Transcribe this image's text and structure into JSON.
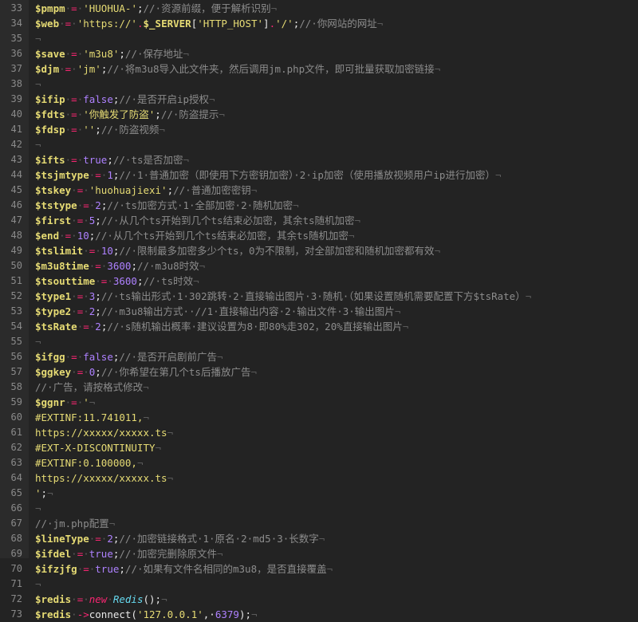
{
  "lines": [
    {
      "num": "33",
      "tokens": [
        {
          "t": "v",
          "x": "$pmpm"
        },
        {
          "t": "w",
          "x": "·"
        },
        {
          "t": "o",
          "x": "="
        },
        {
          "t": "w",
          "x": "·"
        },
        {
          "t": "s",
          "x": "'HUOHUA-'"
        },
        {
          "t": "t",
          "x": ";"
        },
        {
          "t": "c",
          "x": "//·资源前缀，便于解析识别"
        },
        {
          "t": "w",
          "x": "¬"
        }
      ]
    },
    {
      "num": "34",
      "tokens": [
        {
          "t": "v",
          "x": "$web"
        },
        {
          "t": "w",
          "x": "·"
        },
        {
          "t": "o",
          "x": "="
        },
        {
          "t": "w",
          "x": "·"
        },
        {
          "t": "s",
          "x": "'https://'"
        },
        {
          "t": "o",
          "x": "."
        },
        {
          "t": "v",
          "x": "$_SERVER"
        },
        {
          "t": "t",
          "x": "["
        },
        {
          "t": "s",
          "x": "'HTTP_HOST'"
        },
        {
          "t": "t",
          "x": "]"
        },
        {
          "t": "o",
          "x": "."
        },
        {
          "t": "s",
          "x": "'/'"
        },
        {
          "t": "t",
          "x": ";"
        },
        {
          "t": "c",
          "x": "//·你网站的网址"
        },
        {
          "t": "w",
          "x": "¬"
        }
      ]
    },
    {
      "num": "35",
      "tokens": [
        {
          "t": "w",
          "x": "¬"
        }
      ]
    },
    {
      "num": "36",
      "tokens": [
        {
          "t": "v",
          "x": "$save"
        },
        {
          "t": "w",
          "x": "·"
        },
        {
          "t": "o",
          "x": "="
        },
        {
          "t": "w",
          "x": "·"
        },
        {
          "t": "s",
          "x": "'m3u8'"
        },
        {
          "t": "t",
          "x": ";"
        },
        {
          "t": "c",
          "x": "//·保存地址"
        },
        {
          "t": "w",
          "x": "¬"
        }
      ]
    },
    {
      "num": "37",
      "tokens": [
        {
          "t": "v",
          "x": "$djm"
        },
        {
          "t": "w",
          "x": "·"
        },
        {
          "t": "o",
          "x": "="
        },
        {
          "t": "w",
          "x": "·"
        },
        {
          "t": "s",
          "x": "'jm'"
        },
        {
          "t": "t",
          "x": ";"
        },
        {
          "t": "c",
          "x": "//·将m3u8导入此文件夹，然后调用jm.php文件，即可批量获取加密链接"
        },
        {
          "t": "w",
          "x": "¬"
        }
      ]
    },
    {
      "num": "38",
      "tokens": [
        {
          "t": "w",
          "x": "¬"
        }
      ]
    },
    {
      "num": "39",
      "tokens": [
        {
          "t": "v",
          "x": "$ifip"
        },
        {
          "t": "w",
          "x": "·"
        },
        {
          "t": "o",
          "x": "="
        },
        {
          "t": "w",
          "x": "·"
        },
        {
          "t": "n",
          "x": "false"
        },
        {
          "t": "t",
          "x": ";"
        },
        {
          "t": "c",
          "x": "//·是否开启ip授权"
        },
        {
          "t": "w",
          "x": "¬"
        }
      ]
    },
    {
      "num": "40",
      "tokens": [
        {
          "t": "v",
          "x": "$fdts"
        },
        {
          "t": "w",
          "x": "·"
        },
        {
          "t": "o",
          "x": "="
        },
        {
          "t": "w",
          "x": "·"
        },
        {
          "t": "s",
          "x": "'你触发了防盗'"
        },
        {
          "t": "t",
          "x": ";"
        },
        {
          "t": "c",
          "x": "//·防盗提示"
        },
        {
          "t": "w",
          "x": "¬"
        }
      ]
    },
    {
      "num": "41",
      "tokens": [
        {
          "t": "v",
          "x": "$fdsp"
        },
        {
          "t": "w",
          "x": "·"
        },
        {
          "t": "o",
          "x": "="
        },
        {
          "t": "w",
          "x": "·"
        },
        {
          "t": "s",
          "x": "''"
        },
        {
          "t": "t",
          "x": ";"
        },
        {
          "t": "c",
          "x": "//·防盗视频"
        },
        {
          "t": "w",
          "x": "¬"
        }
      ]
    },
    {
      "num": "42",
      "tokens": [
        {
          "t": "w",
          "x": "¬"
        }
      ]
    },
    {
      "num": "43",
      "tokens": [
        {
          "t": "v",
          "x": "$ifts"
        },
        {
          "t": "w",
          "x": "·"
        },
        {
          "t": "o",
          "x": "="
        },
        {
          "t": "w",
          "x": "·"
        },
        {
          "t": "n",
          "x": "true"
        },
        {
          "t": "t",
          "x": ";"
        },
        {
          "t": "c",
          "x": "//·ts是否加密"
        },
        {
          "t": "w",
          "x": "¬"
        }
      ]
    },
    {
      "num": "44",
      "tokens": [
        {
          "t": "v",
          "x": "$tsjmtype"
        },
        {
          "t": "w",
          "x": "·"
        },
        {
          "t": "o",
          "x": "="
        },
        {
          "t": "w",
          "x": "·"
        },
        {
          "t": "n",
          "x": "1"
        },
        {
          "t": "t",
          "x": ";"
        },
        {
          "t": "c",
          "x": "//·1·普通加密（即使用下方密钥加密）·2·ip加密（使用播放视频用户ip进行加密）"
        },
        {
          "t": "w",
          "x": "¬"
        }
      ]
    },
    {
      "num": "45",
      "tokens": [
        {
          "t": "v",
          "x": "$tskey"
        },
        {
          "t": "w",
          "x": "·"
        },
        {
          "t": "o",
          "x": "="
        },
        {
          "t": "w",
          "x": "·"
        },
        {
          "t": "s",
          "x": "'huohuajiexi'"
        },
        {
          "t": "t",
          "x": ";"
        },
        {
          "t": "c",
          "x": "//·普通加密密钥"
        },
        {
          "t": "w",
          "x": "¬"
        }
      ]
    },
    {
      "num": "46",
      "tokens": [
        {
          "t": "v",
          "x": "$tstype"
        },
        {
          "t": "w",
          "x": "·"
        },
        {
          "t": "o",
          "x": "="
        },
        {
          "t": "w",
          "x": "·"
        },
        {
          "t": "n",
          "x": "2"
        },
        {
          "t": "t",
          "x": ";"
        },
        {
          "t": "c",
          "x": "//·ts加密方式·1·全部加密·2·随机加密"
        },
        {
          "t": "w",
          "x": "¬"
        }
      ]
    },
    {
      "num": "47",
      "tokens": [
        {
          "t": "v",
          "x": "$first"
        },
        {
          "t": "w",
          "x": "·"
        },
        {
          "t": "o",
          "x": "="
        },
        {
          "t": "w",
          "x": "·"
        },
        {
          "t": "n",
          "x": "5"
        },
        {
          "t": "t",
          "x": ";"
        },
        {
          "t": "c",
          "x": "//·从几个ts开始到几个ts结束必加密，其余ts随机加密"
        },
        {
          "t": "w",
          "x": "¬"
        }
      ]
    },
    {
      "num": "48",
      "tokens": [
        {
          "t": "v",
          "x": "$end"
        },
        {
          "t": "w",
          "x": "·"
        },
        {
          "t": "o",
          "x": "="
        },
        {
          "t": "w",
          "x": "·"
        },
        {
          "t": "n",
          "x": "10"
        },
        {
          "t": "t",
          "x": ";"
        },
        {
          "t": "c",
          "x": "//·从几个ts开始到几个ts结束必加密，其余ts随机加密"
        },
        {
          "t": "w",
          "x": "¬"
        }
      ]
    },
    {
      "num": "49",
      "tokens": [
        {
          "t": "v",
          "x": "$tslimit"
        },
        {
          "t": "w",
          "x": "·"
        },
        {
          "t": "o",
          "x": "="
        },
        {
          "t": "w",
          "x": "·"
        },
        {
          "t": "n",
          "x": "10"
        },
        {
          "t": "t",
          "x": ";"
        },
        {
          "t": "c",
          "x": "//·限制最多加密多少个ts，0为不限制，对全部加密和随机加密都有效"
        },
        {
          "t": "w",
          "x": "¬"
        }
      ]
    },
    {
      "num": "50",
      "tokens": [
        {
          "t": "v",
          "x": "$m3u8time"
        },
        {
          "t": "w",
          "x": "·"
        },
        {
          "t": "o",
          "x": "="
        },
        {
          "t": "w",
          "x": "·"
        },
        {
          "t": "n",
          "x": "3600"
        },
        {
          "t": "t",
          "x": ";"
        },
        {
          "t": "c",
          "x": "//·m3u8时效"
        },
        {
          "t": "w",
          "x": "¬"
        }
      ]
    },
    {
      "num": "51",
      "tokens": [
        {
          "t": "v",
          "x": "$tsouttime"
        },
        {
          "t": "w",
          "x": "·"
        },
        {
          "t": "o",
          "x": "="
        },
        {
          "t": "w",
          "x": "·"
        },
        {
          "t": "n",
          "x": "3600"
        },
        {
          "t": "t",
          "x": ";"
        },
        {
          "t": "c",
          "x": "//·ts时效"
        },
        {
          "t": "w",
          "x": "¬"
        }
      ]
    },
    {
      "num": "52",
      "tokens": [
        {
          "t": "v",
          "x": "$type1"
        },
        {
          "t": "w",
          "x": "·"
        },
        {
          "t": "o",
          "x": "="
        },
        {
          "t": "w",
          "x": "·"
        },
        {
          "t": "n",
          "x": "3"
        },
        {
          "t": "t",
          "x": ";"
        },
        {
          "t": "c",
          "x": "//·ts输出形式·1·302跳转·2·直接输出图片·3·随机·（如果设置随机需要配置下方$tsRate）"
        },
        {
          "t": "w",
          "x": "¬"
        }
      ]
    },
    {
      "num": "53",
      "tokens": [
        {
          "t": "v",
          "x": "$type2"
        },
        {
          "t": "w",
          "x": "·"
        },
        {
          "t": "o",
          "x": "="
        },
        {
          "t": "w",
          "x": "·"
        },
        {
          "t": "n",
          "x": "2"
        },
        {
          "t": "t",
          "x": ";"
        },
        {
          "t": "c",
          "x": "//·m3u8输出方式··//1·直接输出内容·2·输出文件·3·输出图片"
        },
        {
          "t": "w",
          "x": "¬"
        }
      ]
    },
    {
      "num": "54",
      "tokens": [
        {
          "t": "v",
          "x": "$tsRate"
        },
        {
          "t": "w",
          "x": "·"
        },
        {
          "t": "o",
          "x": "="
        },
        {
          "t": "w",
          "x": "·"
        },
        {
          "t": "n",
          "x": "2"
        },
        {
          "t": "t",
          "x": ";"
        },
        {
          "t": "c",
          "x": "//·s随机输出概率·建议设置为8·即80%走302，20%直接输出图片"
        },
        {
          "t": "w",
          "x": "¬"
        }
      ]
    },
    {
      "num": "55",
      "tokens": [
        {
          "t": "w",
          "x": "¬"
        }
      ]
    },
    {
      "num": "56",
      "tokens": [
        {
          "t": "v",
          "x": "$ifgg"
        },
        {
          "t": "w",
          "x": "·"
        },
        {
          "t": "o",
          "x": "="
        },
        {
          "t": "w",
          "x": "·"
        },
        {
          "t": "n",
          "x": "false"
        },
        {
          "t": "t",
          "x": ";"
        },
        {
          "t": "c",
          "x": "//·是否开启剧前广告"
        },
        {
          "t": "w",
          "x": "¬"
        }
      ]
    },
    {
      "num": "57",
      "tokens": [
        {
          "t": "v",
          "x": "$ggkey"
        },
        {
          "t": "w",
          "x": "·"
        },
        {
          "t": "o",
          "x": "="
        },
        {
          "t": "w",
          "x": "·"
        },
        {
          "t": "n",
          "x": "0"
        },
        {
          "t": "t",
          "x": ";"
        },
        {
          "t": "c",
          "x": "//·你希望在第几个ts后播放广告"
        },
        {
          "t": "w",
          "x": "¬"
        }
      ]
    },
    {
      "num": "58",
      "tokens": [
        {
          "t": "c",
          "x": "//·广告，请按格式修改"
        },
        {
          "t": "w",
          "x": "¬"
        }
      ]
    },
    {
      "num": "59",
      "tokens": [
        {
          "t": "v",
          "x": "$ggnr"
        },
        {
          "t": "w",
          "x": "·"
        },
        {
          "t": "o",
          "x": "="
        },
        {
          "t": "w",
          "x": "·"
        },
        {
          "t": "s",
          "x": "'"
        },
        {
          "t": "w",
          "x": "¬"
        }
      ]
    },
    {
      "num": "60",
      "tokens": [
        {
          "t": "s",
          "x": "#EXTINF:11.741011,"
        },
        {
          "t": "w",
          "x": "¬"
        }
      ]
    },
    {
      "num": "61",
      "tokens": [
        {
          "t": "s",
          "x": "https://xxxxx/xxxxx.ts"
        },
        {
          "t": "w",
          "x": "¬"
        }
      ]
    },
    {
      "num": "62",
      "tokens": [
        {
          "t": "s",
          "x": "#EXT-X-DISCONTINUITY"
        },
        {
          "t": "w",
          "x": "¬"
        }
      ]
    },
    {
      "num": "63",
      "tokens": [
        {
          "t": "s",
          "x": "#EXTINF:0.100000,"
        },
        {
          "t": "w",
          "x": "¬"
        }
      ]
    },
    {
      "num": "64",
      "tokens": [
        {
          "t": "s",
          "x": "https://xxxxx/xxxxx.ts"
        },
        {
          "t": "w",
          "x": "¬"
        }
      ]
    },
    {
      "num": "65",
      "tokens": [
        {
          "t": "s",
          "x": "'"
        },
        {
          "t": "t",
          "x": ";"
        },
        {
          "t": "w",
          "x": "¬"
        }
      ]
    },
    {
      "num": "66",
      "tokens": [
        {
          "t": "w",
          "x": "¬"
        }
      ]
    },
    {
      "num": "67",
      "tokens": [
        {
          "t": "c",
          "x": "//·jm.php配置"
        },
        {
          "t": "w",
          "x": "¬"
        }
      ]
    },
    {
      "num": "68",
      "tokens": [
        {
          "t": "v",
          "x": "$lineType"
        },
        {
          "t": "w",
          "x": "·"
        },
        {
          "t": "o",
          "x": "="
        },
        {
          "t": "w",
          "x": "·"
        },
        {
          "t": "n",
          "x": "2"
        },
        {
          "t": "t",
          "x": ";"
        },
        {
          "t": "c",
          "x": "//·加密链接格式·1·原名·2·md5·3·长数字"
        },
        {
          "t": "w",
          "x": "¬"
        }
      ]
    },
    {
      "num": "69",
      "tokens": [
        {
          "t": "v",
          "x": "$ifdel"
        },
        {
          "t": "w",
          "x": "·"
        },
        {
          "t": "o",
          "x": "="
        },
        {
          "t": "w",
          "x": "·"
        },
        {
          "t": "n",
          "x": "true"
        },
        {
          "t": "t",
          "x": ";"
        },
        {
          "t": "c",
          "x": "//·加密完删除原文件"
        },
        {
          "t": "w",
          "x": "¬"
        }
      ]
    },
    {
      "num": "70",
      "tokens": [
        {
          "t": "v",
          "x": "$ifzjfg"
        },
        {
          "t": "w",
          "x": "·"
        },
        {
          "t": "o",
          "x": "="
        },
        {
          "t": "w",
          "x": "·"
        },
        {
          "t": "n",
          "x": "true"
        },
        {
          "t": "t",
          "x": ";"
        },
        {
          "t": "c",
          "x": "//·如果有文件名相同的m3u8，是否直接覆盖"
        },
        {
          "t": "w",
          "x": "¬"
        }
      ]
    },
    {
      "num": "71",
      "tokens": [
        {
          "t": "w",
          "x": "¬"
        }
      ]
    },
    {
      "num": "72",
      "tokens": [
        {
          "t": "v",
          "x": "$redis"
        },
        {
          "t": "w",
          "x": "·"
        },
        {
          "t": "o",
          "x": "="
        },
        {
          "t": "w",
          "x": "·"
        },
        {
          "t": "k",
          "x": "new"
        },
        {
          "t": "w",
          "x": "·"
        },
        {
          "t": "cls",
          "x": "Redis"
        },
        {
          "t": "t",
          "x": "();"
        },
        {
          "t": "w",
          "x": "¬"
        }
      ]
    },
    {
      "num": "73",
      "tokens": [
        {
          "t": "v",
          "x": "$redis"
        },
        {
          "t": "w",
          "x": "·"
        },
        {
          "t": "o",
          "x": "->"
        },
        {
          "t": "t",
          "x": "connect("
        },
        {
          "t": "s",
          "x": "'127.0.0.1'"
        },
        {
          "t": "t",
          "x": ",·"
        },
        {
          "t": "n",
          "x": "6379"
        },
        {
          "t": "t",
          "x": ");"
        },
        {
          "t": "w",
          "x": "¬"
        }
      ]
    }
  ]
}
